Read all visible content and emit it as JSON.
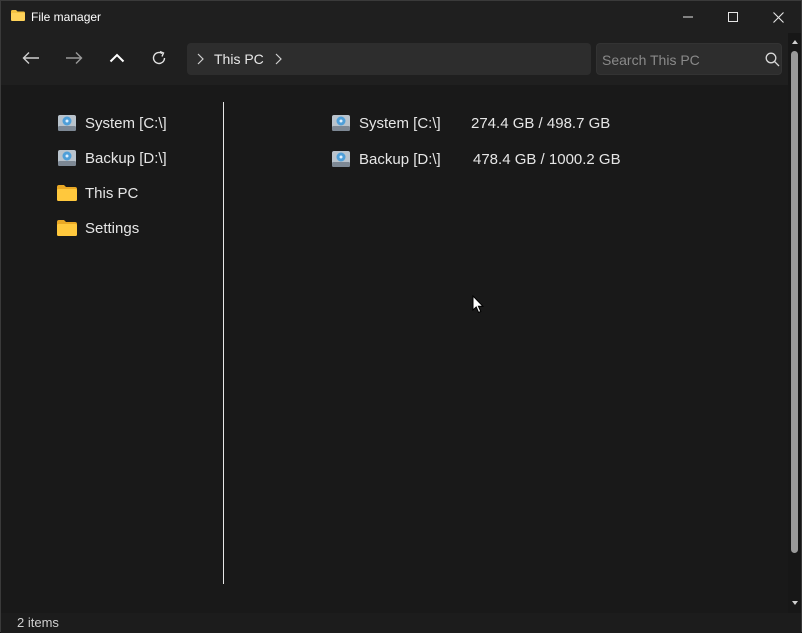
{
  "window": {
    "title": "File manager",
    "controls": [
      "minimize",
      "maximize",
      "close"
    ]
  },
  "toolbar": {
    "back_icon": "arrow-left-icon",
    "forward_icon": "arrow-right-icon",
    "up_icon": "chevron-up-icon",
    "refresh_icon": "refresh-icon",
    "breadcrumb": [
      "This PC"
    ],
    "search_placeholder": "Search This PC"
  },
  "sidebar": {
    "items": [
      {
        "label": "System [C:\\]",
        "icon": "drive-icon"
      },
      {
        "label": "Backup [D:\\]",
        "icon": "drive-icon"
      },
      {
        "label": "This PC",
        "icon": "folder-icon"
      },
      {
        "label": "Settings",
        "icon": "folder-icon"
      }
    ]
  },
  "main": {
    "items": [
      {
        "name": "System [C:\\]",
        "size": "274.4 GB / 498.7 GB",
        "icon": "drive-icon"
      },
      {
        "name": "Backup [D:\\]",
        "size": "478.4 GB / 1000.2 GB",
        "icon": "drive-icon"
      }
    ]
  },
  "status": {
    "items_count": "2 items"
  },
  "colors": {
    "background": "#191919",
    "toolbar": "#1f1f1f",
    "address_bg": "#2d2d2d",
    "folder": "#f5c443",
    "drive": "#5aa6d6"
  }
}
